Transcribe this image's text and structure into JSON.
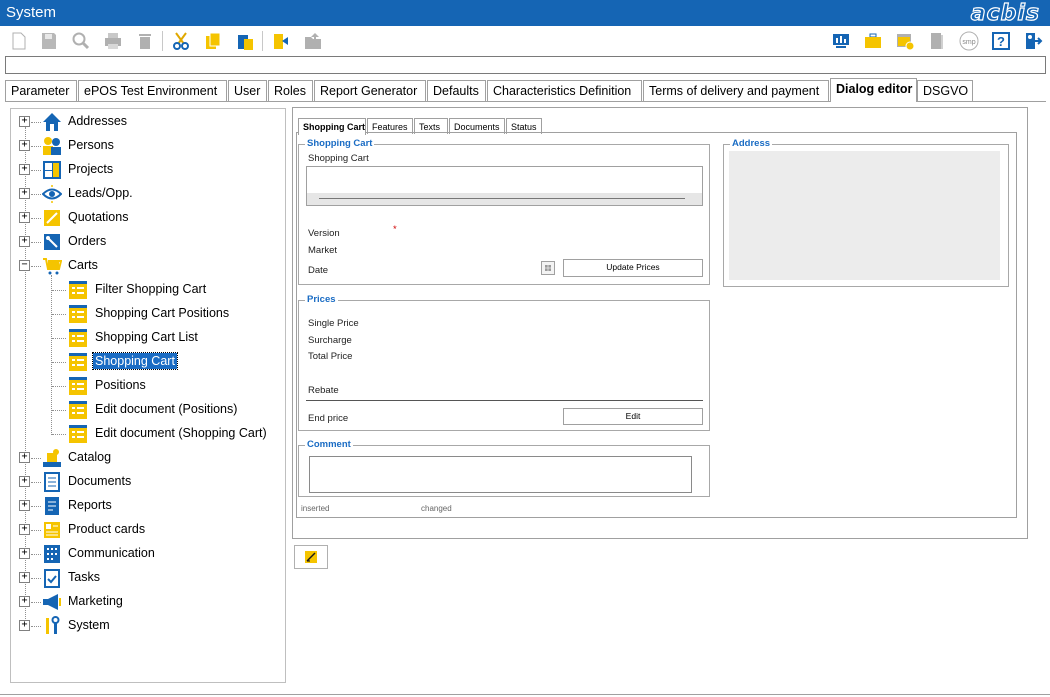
{
  "window": {
    "title": "System",
    "brand": "acbis"
  },
  "tabs": [
    {
      "label": "Parameter"
    },
    {
      "label": "ePOS Test Environment"
    },
    {
      "label": "User"
    },
    {
      "label": "Roles"
    },
    {
      "label": "Report Generator"
    },
    {
      "label": "Defaults"
    },
    {
      "label": "Characteristics Definition"
    },
    {
      "label": "Terms of delivery and payment"
    },
    {
      "label": "Dialog editor"
    },
    {
      "label": "DSGVO"
    }
  ],
  "active_tab": "Dialog editor",
  "tree": {
    "items": [
      {
        "label": "Addresses",
        "icon": "house-icon"
      },
      {
        "label": "Persons",
        "icon": "persons-icon"
      },
      {
        "label": "Projects",
        "icon": "projects-icon"
      },
      {
        "label": "Leads/Opp.",
        "icon": "eye-icon"
      },
      {
        "label": "Quotations",
        "icon": "pencil-icon"
      },
      {
        "label": "Orders",
        "icon": "orders-icon"
      },
      {
        "label": "Carts",
        "icon": "cart-icon"
      },
      {
        "label": "Filter Shopping Cart",
        "icon": "form-icon"
      },
      {
        "label": "Shopping Cart Positions",
        "icon": "form-icon"
      },
      {
        "label": "Shopping Cart List",
        "icon": "form-icon"
      },
      {
        "label": "Shopping Cart",
        "icon": "form-icon"
      },
      {
        "label": "Positions",
        "icon": "form-icon"
      },
      {
        "label": "Edit document (Positions)",
        "icon": "form-icon"
      },
      {
        "label": "Edit document (Shopping Cart)",
        "icon": "form-icon"
      },
      {
        "label": "Catalog",
        "icon": "catalog-icon"
      },
      {
        "label": "Documents",
        "icon": "document-icon"
      },
      {
        "label": "Reports",
        "icon": "report-icon"
      },
      {
        "label": "Product cards",
        "icon": "productcard-icon"
      },
      {
        "label": "Communication",
        "icon": "communication-icon"
      },
      {
        "label": "Tasks",
        "icon": "tasks-icon"
      },
      {
        "label": "Marketing",
        "icon": "megaphone-icon"
      },
      {
        "label": "System",
        "icon": "tools-icon"
      }
    ],
    "selected": "Shopping Cart"
  },
  "dialog": {
    "subtabs": [
      {
        "label": "Shopping Cart"
      },
      {
        "label": "Features"
      },
      {
        "label": "Texts"
      },
      {
        "label": "Documents"
      },
      {
        "label": "Status"
      }
    ],
    "shopping_cart_group": {
      "legend": "Shopping Cart",
      "field_label": "Shopping Cart",
      "version": "Version",
      "required_mark": "*",
      "market": "Market",
      "date": "Date",
      "update_button": "Update Prices"
    },
    "address_group": {
      "legend": "Address"
    },
    "prices_group": {
      "legend": "Prices",
      "single_price": "Single Price",
      "surcharge": "Surcharge",
      "total_price": "Total Price",
      "rebate": "Rebate",
      "end_price": "End price",
      "edit_button": "Edit"
    },
    "comment_group": {
      "legend": "Comment"
    },
    "footer": {
      "inserted": "inserted",
      "changed": "changed"
    }
  },
  "colors": {
    "titlebar": "#1565b4",
    "accent": "#1a6cc4",
    "icon_yellow": "#f5c400"
  }
}
